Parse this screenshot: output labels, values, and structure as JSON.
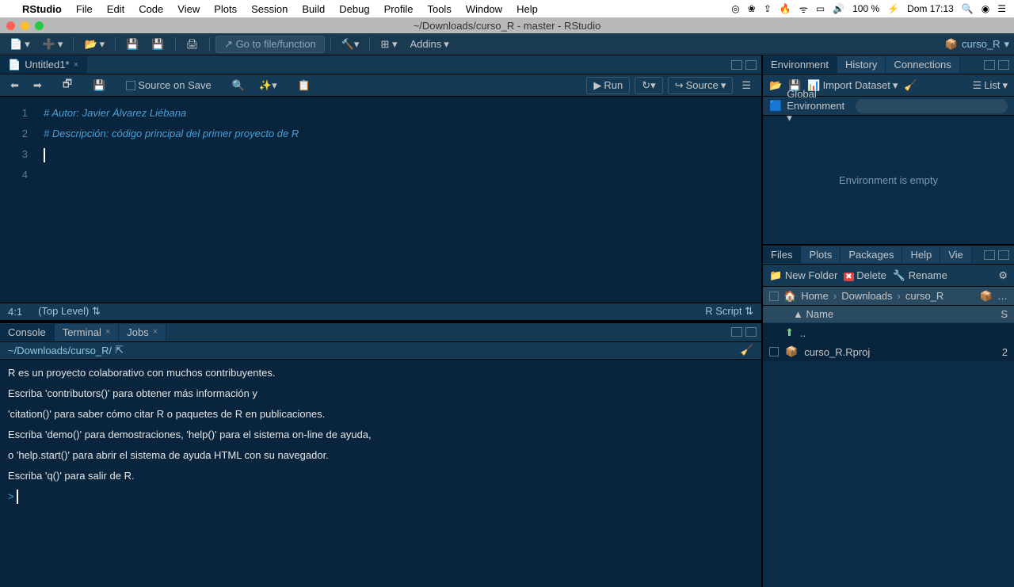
{
  "menubar": {
    "app": "RStudio",
    "items": [
      "File",
      "Edit",
      "Code",
      "View",
      "Plots",
      "Session",
      "Build",
      "Debug",
      "Profile",
      "Tools",
      "Window",
      "Help"
    ],
    "battery": "100 %",
    "clock": "Dom 17:13"
  },
  "titlebar": "~/Downloads/curso_R - master - RStudio",
  "toolbar": {
    "gotofile": "Go to file/function",
    "addins": "Addins",
    "project": "curso_R"
  },
  "source": {
    "tab": "Untitled1*",
    "source_on_save": "Source on Save",
    "run": "Run",
    "srcbtn": "Source",
    "lines": [
      "",
      "# Autor: Javier Álvarez Liébana",
      "# Descripción: código principal del primer proyecto de R",
      ""
    ],
    "status_pos": "4:1",
    "status_scope": "(Top Level)",
    "status_type": "R Script"
  },
  "console": {
    "tabs": [
      "Console",
      "Terminal",
      "Jobs"
    ],
    "path": "~/Downloads/curso_R/",
    "lines": [
      "R es un proyecto colaborativo con muchos contribuyentes.",
      "Escriba 'contributors()' para obtener más información y",
      "'citation()' para saber cómo citar R o paquetes de R en publicaciones.",
      "",
      "Escriba 'demo()' para demostraciones, 'help()' para el sistema on-line de ayuda,",
      "o 'help.start()' para abrir el sistema de ayuda HTML con su navegador.",
      "Escriba 'q()' para salir de R.",
      ""
    ],
    "prompt": ">"
  },
  "env": {
    "tabs": [
      "Environment",
      "History",
      "Connections"
    ],
    "import": "Import Dataset",
    "list": "List",
    "scope": "Global Environment",
    "empty": "Environment is empty"
  },
  "files": {
    "tabs": [
      "Files",
      "Plots",
      "Packages",
      "Help",
      "Vie"
    ],
    "newfolder": "New Folder",
    "delete": "Delete",
    "rename": "Rename",
    "breadcrumb": [
      "Home",
      "Downloads",
      "curso_R"
    ],
    "header": "Name",
    "header_s": "S",
    "rows": [
      {
        "name": "..",
        "icon": "up"
      },
      {
        "name": "curso_R.Rproj",
        "icon": "rproj",
        "s": "2"
      }
    ]
  }
}
